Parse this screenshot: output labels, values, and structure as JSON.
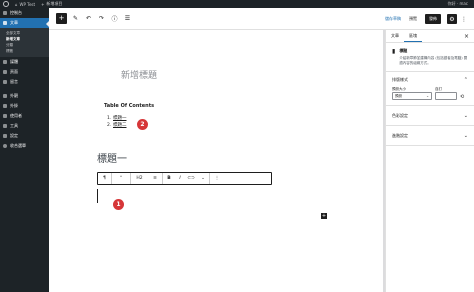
{
  "adminbar": {
    "site_name": "WP Test",
    "new_post_label": "新增項目",
    "howdy": "你好 · mac"
  },
  "menu": {
    "items": [
      {
        "label": "控制台"
      },
      {
        "label": "文章",
        "active": true
      },
      {
        "label": "媒體"
      },
      {
        "label": "頁面"
      },
      {
        "label": "留言"
      },
      {
        "label": "外觀"
      },
      {
        "label": "外掛"
      },
      {
        "label": "使用者"
      },
      {
        "label": "工具"
      },
      {
        "label": "設定"
      },
      {
        "label": "收合選單"
      }
    ],
    "submenu": [
      "全部文章",
      "新增文章",
      "分類",
      "標籤"
    ]
  },
  "toolbar": {
    "save_draft": "儲存草稿",
    "preview": "預覽",
    "publish": "發佈"
  },
  "canvas": {
    "post_title_placeholder": "新增標題",
    "toc_title": "Table Of Contents",
    "toc_items": [
      {
        "num": "1.",
        "text": "標題一"
      },
      {
        "num": "2.",
        "text": "標題二"
      }
    ],
    "heading": "標題一",
    "heading_level": "H2",
    "badge_1": "1",
    "badge_2": "2"
  },
  "sidebar": {
    "tabs": [
      "文章",
      "區塊"
    ],
    "block_name": "標題",
    "block_description": "介紹新章節並建構內容 (包括讀者及電腦) 閱讀內容的組織方式。",
    "panels": {
      "typography": "排版樣式",
      "preset_size": "預設大小",
      "preset_value": "預設",
      "custom": "自訂",
      "color": "色彩設定",
      "advanced": "進階設定"
    }
  }
}
